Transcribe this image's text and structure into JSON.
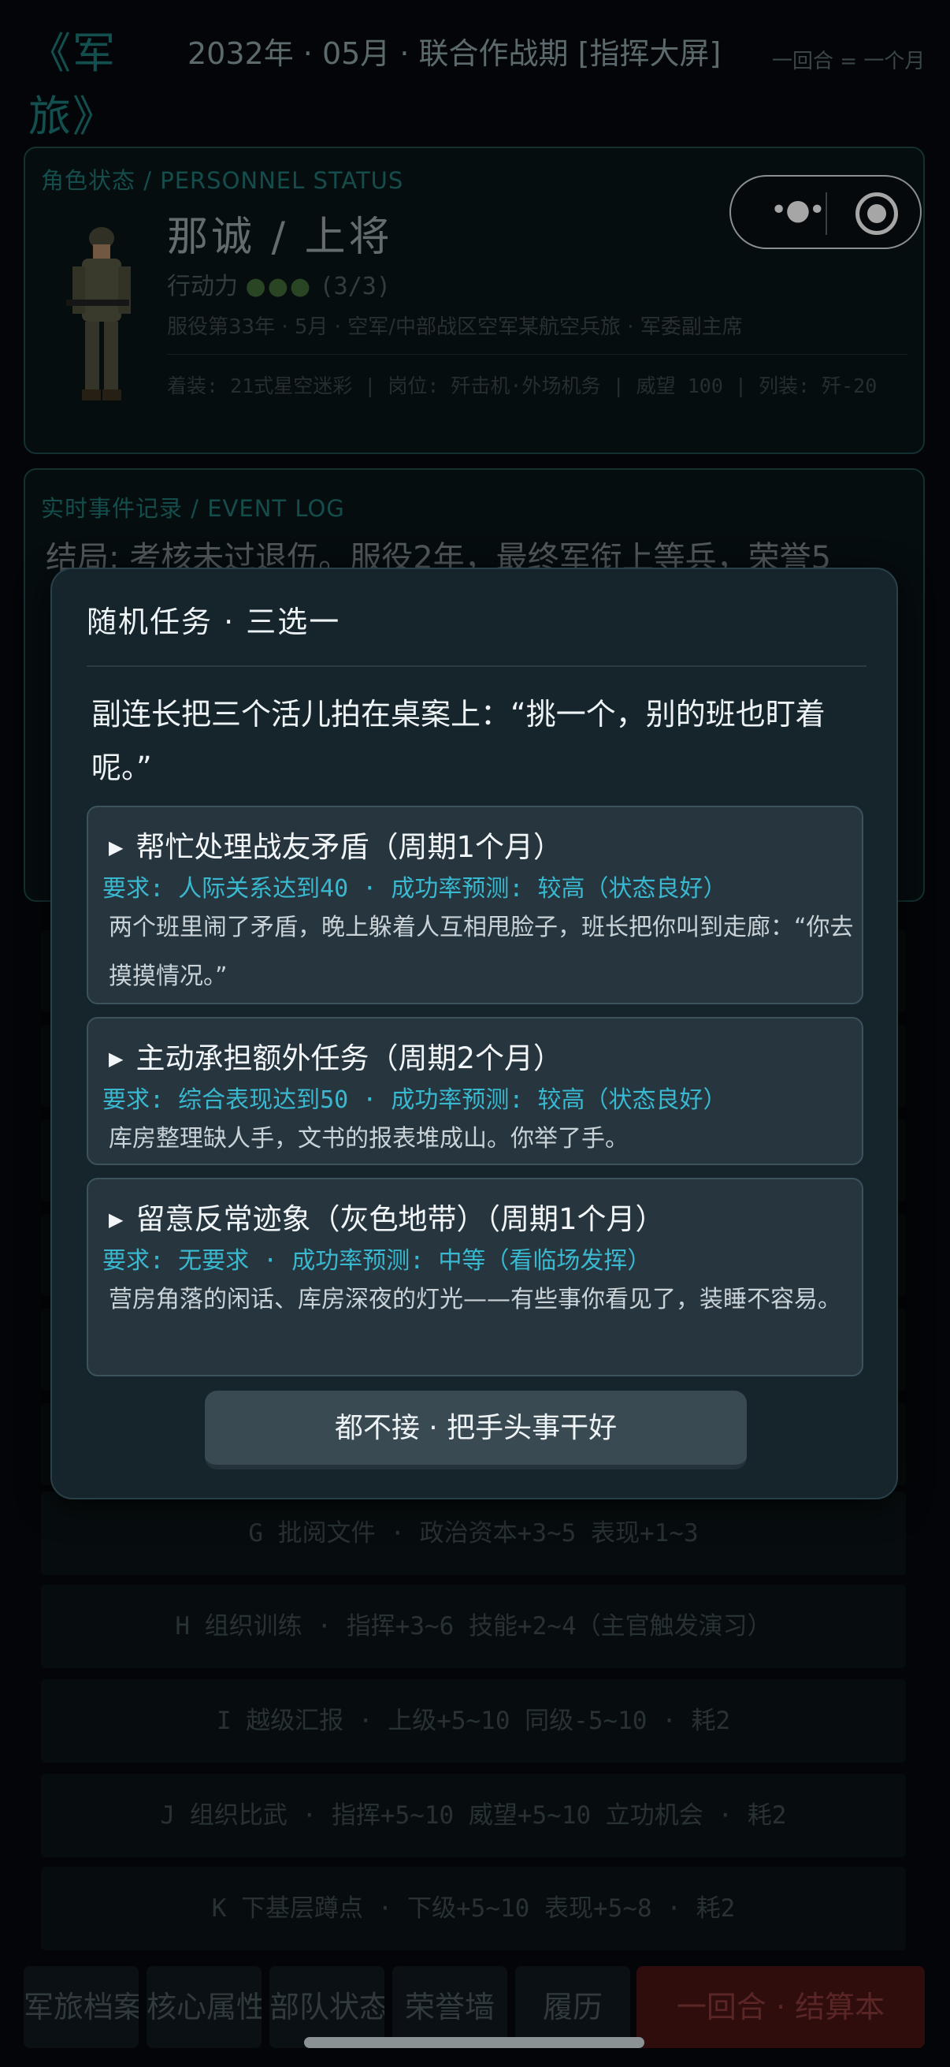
{
  "header": {
    "app_title": "《军旅》",
    "date_line": "2032年 · 05月 · 联合作战期 [指挥大屏]",
    "turn_note": "一回合 = 一个月"
  },
  "status": {
    "label": "角色状态 / PERSONNEL STATUS",
    "name_rank": "那诚 / 上将",
    "action_label": "行动力",
    "action_dots": "●●●",
    "action_count": "(3/3)",
    "service_line": "服役第33年 · 5月 · 空军/中部战区空军某航空兵旅 · 军委副主席",
    "equip_line": "着装: 21式星空迷彩 | 岗位: 歼击机·外场机务 | 威望 100 | 列装: 歼-20"
  },
  "event_log": {
    "label": "实时事件记录 / EVENT LOG",
    "text": "结局: 考核未过退伍。服役2年，最终军衔上等兵，荣誉5"
  },
  "actions": [
    {
      "label": "G 批阅文件 · 政治资本+3~5 表现+1~3"
    },
    {
      "label": "H 组织训练 · 指挥+3~6 技能+2~4（主官触发演习）"
    },
    {
      "label": "I 越级汇报 · 上级+5~10 同级-5~10 · 耗2"
    },
    {
      "label": "J 组织比武 · 指挥+5~10 威望+5~10 立功机会 · 耗2"
    },
    {
      "label": "K 下基层蹲点 · 下级+5~10 表现+5~8 · 耗2"
    }
  ],
  "bottom_tabs": [
    {
      "label": "军旅档案"
    },
    {
      "label": "核心属性"
    },
    {
      "label": "部队状态"
    },
    {
      "label": "荣誉墙"
    },
    {
      "label": "履历"
    },
    {
      "label": "一回合 · 结算本"
    }
  ],
  "modal": {
    "title": "随机任务 · 三选一",
    "intro": "副连长把三个活儿拍在桌案上：“挑一个，别的班也盯着呢。”",
    "tasks": [
      {
        "title": "帮忙处理战友矛盾（周期1个月）",
        "req": "要求: 人际关系达到40 · 成功率预测: 较高（状态良好）",
        "desc": "两个班里闹了矛盾，晚上躲着人互相甩脸子，班长把你叫到走廊：“你去摸摸情况。”"
      },
      {
        "title": "主动承担额外任务（周期2个月）",
        "req": "要求: 综合表现达到50 · 成功率预测: 较高（状态良好）",
        "desc": "库房整理缺人手，文书的报表堆成山。你举了手。"
      },
      {
        "title": "留意反常迹象（灰色地带）（周期1个月）",
        "req": "要求: 无要求 · 成功率预测: 中等（看临场发挥）",
        "desc": "营房角落的闲话、库房深夜的灯光——有些事你看见了，装睡不容易。"
      }
    ],
    "decline_label": "都不接 · 把手头事干好"
  },
  "colors": {
    "accent_teal": "#1f7774",
    "requirement_cyan": "#39b8cf",
    "end_turn_red": "#4a1414",
    "modal_bg": "#16242c"
  }
}
